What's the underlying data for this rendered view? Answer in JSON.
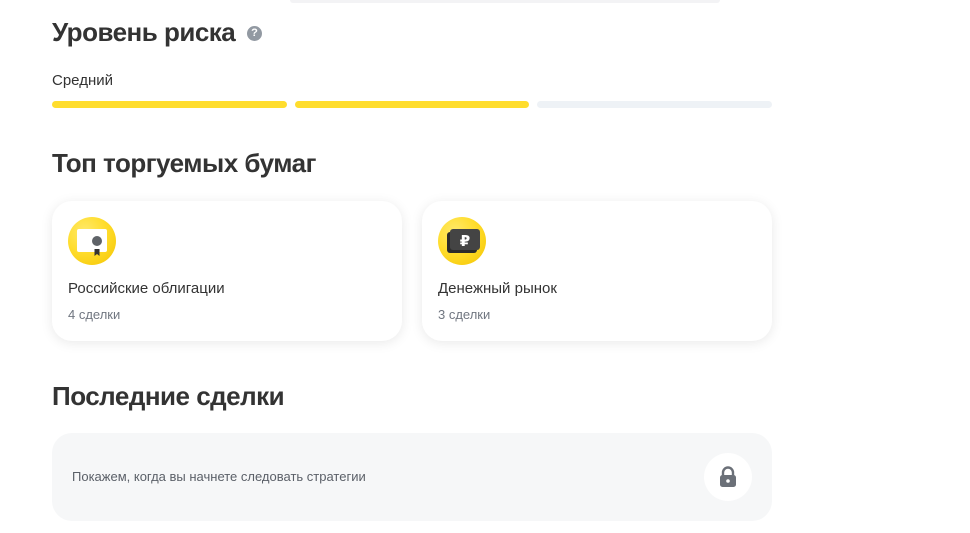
{
  "risk": {
    "title": "Уровень риска",
    "help_icon": "?",
    "level_label": "Средний",
    "level_filled": 2,
    "level_total": 3,
    "accent_color": "#ffdd2d"
  },
  "top_securities": {
    "title": "Топ торгуемых бумаг",
    "cards": [
      {
        "name": "Российские облигации",
        "count": "4 сделки",
        "icon": "bond-certificate-icon"
      },
      {
        "name": "Денежный рынок",
        "count": "3 сделки",
        "icon": "ruble-wallet-icon"
      }
    ]
  },
  "last_deals": {
    "title": "Последние сделки",
    "empty_text": "Покажем, когда вы начнете следовать стратегии",
    "lock_icon": "lock-icon"
  }
}
